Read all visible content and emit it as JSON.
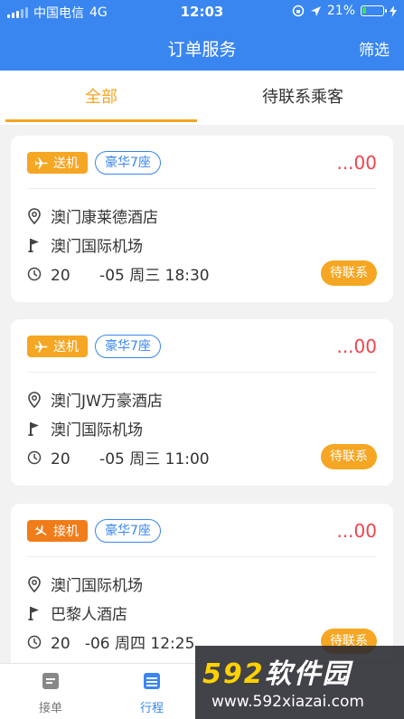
{
  "status_bar": {
    "carrier": "中国电信",
    "network": "4G",
    "time": "12:03",
    "battery": "21%",
    "battery_level": 0.21
  },
  "nav": {
    "title": "订单服务",
    "filter_label": "筛选"
  },
  "tabs": [
    {
      "label": "全部",
      "active": true
    },
    {
      "label": "待联系乘客",
      "active": false
    }
  ],
  "orders": [
    {
      "type_label": "送机",
      "seat_label": "豪华7座",
      "price": "...00",
      "from": "澳门康莱德酒店",
      "to": "澳门国际机场",
      "time": "20      -05 周三 18:30",
      "action_label": "待联系"
    },
    {
      "type_label": "送机",
      "seat_label": "豪华7座",
      "price": "...00",
      "from": "澳门JW万豪酒店",
      "to": "澳门国际机场",
      "time": "20      -05 周三 11:00",
      "action_label": "待联系"
    },
    {
      "type_label": "接机",
      "seat_label": "豪华7座",
      "price": "...00",
      "from": "澳门国际机场",
      "to": "巴黎人酒店",
      "time": "20   -06 周四 12:25",
      "action_label": "待联系"
    }
  ],
  "bottom_nav": [
    {
      "label": "接单",
      "active": false
    },
    {
      "label": "行程",
      "active": true
    }
  ],
  "watermark": {
    "brand_num": "592",
    "brand_text": "软件园",
    "url": "www.592xiazai.com"
  },
  "colors": {
    "primary": "#3a86f0",
    "accent": "#f5a623",
    "pickup": "#f07c1a",
    "price": "#f0434d"
  }
}
